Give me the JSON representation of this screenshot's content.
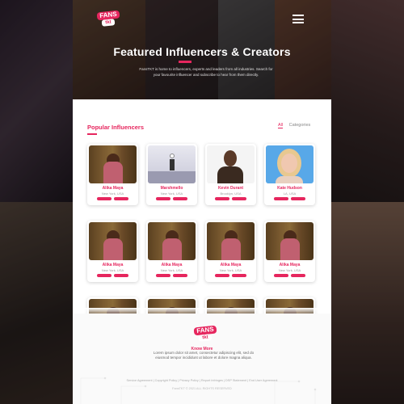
{
  "brand": {
    "logo_text": "FANS",
    "logo_sub": "tkt",
    "accent": "#e6265e"
  },
  "hero": {
    "title": "Featured Influencers & Creators",
    "description": "FansTKT is home to influencers, experts and leaders from all industries. Search for your favourite influencer and subscribe to hear from them directly."
  },
  "section": {
    "title": "Popular Influencers",
    "filters": [
      "All",
      "Categories"
    ],
    "active_filter": "All"
  },
  "cards": [
    {
      "name": "Alika Maya",
      "location": "New York, USA",
      "photo": "forest"
    },
    {
      "name": "Marshmello",
      "location": "New York, USA",
      "photo": "stage"
    },
    {
      "name": "Kevin Durant",
      "location": "Brooklyn, USA",
      "photo": "portrait-dark"
    },
    {
      "name": "Kate Hudson",
      "location": "LA, USA",
      "photo": "portrait-light"
    },
    {
      "name": "Alika Maya",
      "location": "New York, USA",
      "photo": "forest"
    },
    {
      "name": "Alika Maya",
      "location": "New York, USA",
      "photo": "forest"
    },
    {
      "name": "Alika Maya",
      "location": "New York, USA",
      "photo": "forest"
    },
    {
      "name": "Alika Maya",
      "location": "New York, USA",
      "photo": "forest"
    },
    {
      "name": "",
      "location": "",
      "photo": "forest"
    },
    {
      "name": "",
      "location": "",
      "photo": "forest"
    },
    {
      "name": "",
      "location": "",
      "photo": "forest"
    },
    {
      "name": "",
      "location": "",
      "photo": "forest"
    }
  ],
  "footer": {
    "know_more": "Know More",
    "text": "Lorem ipsum dolor sit amet, consectetur adipiscing elit, sed do eiusmod tempor incididunt ut labore et dolore magna aliqua.",
    "links": "Service Agreement | Copyright Policy | Privacy Policy | Report Infringes | DSP Statement | End User Agreement",
    "copyright": "FansTKT © 2021 ALL RIGHTS RESERVED"
  }
}
